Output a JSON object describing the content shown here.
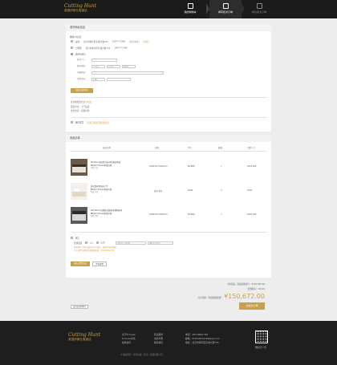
{
  "header": {
    "logo_script": "Cutting Hunt",
    "logo_cn": "英国伊莱仕客酒店",
    "steps": [
      {
        "label": "我的购物车",
        "state": "done"
      },
      {
        "label": "填写核对订单",
        "state": "active"
      },
      {
        "label": "成功提交订单",
        "state": "todo"
      }
    ]
  },
  "receiver": {
    "title": "收货地址信息",
    "subtitle": "收货人信息",
    "addresses": [
      {
        "name": "凌晴",
        "address": "北京市朝平区东城大厦735",
        "phone": "158****2365",
        "default_label": "[默认地址]",
        "edit": "[修改]",
        "selected": false
      },
      {
        "name": "王明明",
        "address": "北京市朝平区东城大厦735",
        "phone": "158****2365",
        "default_label": "",
        "edit": "",
        "selected": false
      },
      {
        "name": "使用新地址",
        "address": "",
        "phone": "",
        "default_label": "",
        "edit": "",
        "selected": true
      }
    ],
    "form": {
      "name_label": "收 件 人：",
      "region_label": "所在地区：",
      "province": "北京市",
      "city": "北京市",
      "district": "朝阳区",
      "street_label": "详细地址：",
      "phone_label": "手机号码：",
      "phone_prefix": "+86"
    },
    "confirm_button": "确认收货地址"
  },
  "payment": {
    "title": "支付和配送方式",
    "edit": "[修改]",
    "pay_method": "配送方式：上门送货",
    "delivery_time": "支付方式：货到付款"
  },
  "invoice": {
    "label": "我的发票",
    "note": "(请您选择是否需要发票)"
  },
  "goods": {
    "title": "商品清单",
    "headers": [
      "商品名称",
      "规格",
      "单价",
      "数量",
      "金额小计"
    ],
    "items": [
      {
        "name": "Dorsten 帕比登·名床舍如新床垫床",
        "brand": "Eltham House伊莱仕客",
        "stock": "现货  4天",
        "spec": "1800mm*2000mm",
        "price": "¥6,888",
        "qty": "1",
        "subtotal": "¥150,000"
      },
      {
        "name": "英式真丝提花床上件",
        "brand": "Eltham House伊莱仕客",
        "stock": "现货  4天",
        "spec": "蓝色   紫色",
        "price": "¥599",
        "qty": "2",
        "subtotal": "¥799"
      },
      {
        "name": "Woodford 伍德福·北欧实木储物床柜",
        "brand": "Eltham House伊莱仕客",
        "stock": "现货  4天",
        "spec": "1800mm*2000mm",
        "price": "¥6,888",
        "qty": "1",
        "subtotal": "¥150,000"
      }
    ]
  },
  "notes": {
    "title": "留言",
    "options": [
      "普通发票",
      "个人",
      "公司"
    ],
    "company_placeholder": "请填写公司名称",
    "tax_placeholder": "纳税人识别号",
    "hint_a": "发票将在订单完成后由专人寄出，请保持电话畅通，",
    "hint_b": "关于发票问题请咨询客服热线：400-6699-769",
    "confirm": "确认发票信息",
    "cancel": "不开发票"
  },
  "totals": {
    "line1": "2件商品，商品金额总计：¥150,000.00",
    "line2": "优惠抵扣：-¥0.00",
    "payable_label": "应付金额（含运费和税费）：",
    "payable": "¥150,672.00",
    "submit": "去提交订单"
  },
  "back_link": "返回修改购物车",
  "footer": {
    "logo_script": "Cutting Hunt",
    "logo_cn": "英国伊莱仕客酒店",
    "col1": [
      "关于E.house",
      "E.house文化",
      "媒体资讯"
    ],
    "col2": [
      "售后服务",
      "法律声明",
      "联系我们"
    ],
    "contact": [
      "电话：400-6699-769",
      "邮箱：ELTHAMHOUSE@qq.com",
      "地址：北京市朝平区东城大厦735"
    ],
    "qr_caption": "微信扫一扫",
    "copyright": "© 版权所有 · 伊莱仕客（北京）商贸有限公司"
  }
}
